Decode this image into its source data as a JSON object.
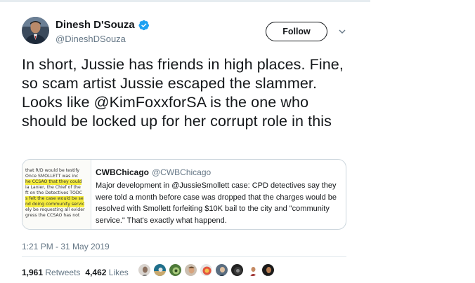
{
  "tweet": {
    "author": {
      "name": "Dinesh D'Souza",
      "handle": "@DineshDSouza",
      "verified": true
    },
    "follow_label": "Follow",
    "text": "In short, Jussie has friends in high places. Fine, so scam artist Jussie escaped the slammer. Looks like @KimFoxxforSA is the one who should be locked up for her corrupt role in this",
    "quote": {
      "name": "CWBChicago",
      "handle": "@CWBChicago",
      "text": "Major development in @JussieSmollett case:  CPD detectives say they were told a month before case was dropped that the charges would be resolved with Smollett forfeiting $10K bail to the city and \"community service.\" That's exactly what happend.",
      "thumbnail_lines": [
        "that R/D would be testify",
        "Once SMOLLETT was inc",
        "he CCSAO that they could",
        "ia Lanier, the Chief of the",
        "ft on the Detectives TODC",
        "s felt the case would be se",
        "nd doing community servic",
        "ely be requesting all evider",
        "gress the CCSAO has not"
      ]
    },
    "timestamp": "1:21 PM - 31 May 2019",
    "retweets_count": "1,961",
    "retweets_label": "Retweets",
    "likes_count": "4,462",
    "likes_label": "Likes",
    "liker_avatars": [
      "avatar-1",
      "avatar-2",
      "avatar-3",
      "avatar-4",
      "avatar-5",
      "avatar-6",
      "avatar-7",
      "avatar-8",
      "avatar-9"
    ],
    "colors": {
      "verified_blue": "#1da1f2",
      "secondary_text": "#657786",
      "border": "#ccd6dd",
      "highlight": "#f5ec3c"
    }
  }
}
